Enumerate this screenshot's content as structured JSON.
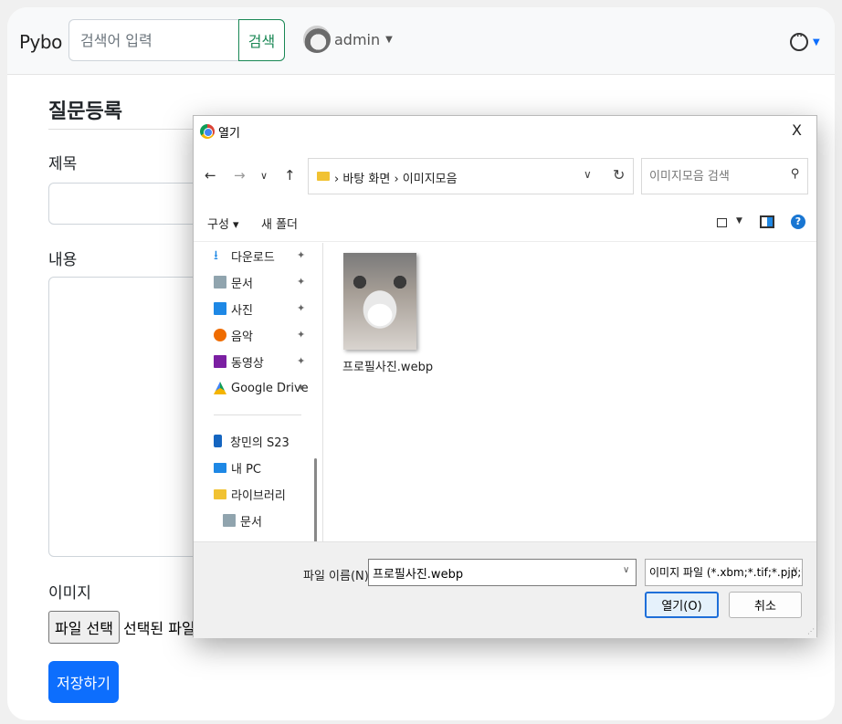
{
  "navbar": {
    "brand": "Pybo",
    "search_placeholder": "검색어 입력",
    "search_button": "검색",
    "username": "admin"
  },
  "form": {
    "title": "질문등록",
    "subject_label": "제목",
    "content_label": "내용",
    "image_label": "이미지",
    "file_button": "파일 선택",
    "file_status": "선택된 파일 없음",
    "save_button": "저장하기"
  },
  "dialog": {
    "title": "열기",
    "close": "X",
    "path": [
      "바탕 화면",
      "이미지모음"
    ],
    "search_placeholder": "이미지모음 검색",
    "toolbar": {
      "organize": "구성 ▾",
      "new_folder": "새 폴더"
    },
    "nav_items": [
      {
        "label": "다운로드",
        "icon": "download-icon",
        "pinned": true
      },
      {
        "label": "문서",
        "icon": "document-icon",
        "pinned": true
      },
      {
        "label": "사진",
        "icon": "pictures-icon",
        "pinned": true
      },
      {
        "label": "음악",
        "icon": "music-icon",
        "pinned": true
      },
      {
        "label": "동영상",
        "icon": "video-icon",
        "pinned": true
      },
      {
        "label": "Google Drive",
        "icon": "google-drive-icon",
        "pinned": true
      },
      {
        "label": "창민의 S23",
        "icon": "phone-icon",
        "pinned": false
      },
      {
        "label": "내 PC",
        "icon": "pc-icon",
        "pinned": false
      },
      {
        "label": "라이브러리",
        "icon": "folder-icon",
        "pinned": false
      },
      {
        "label": "문서",
        "icon": "document-icon",
        "pinned": false
      }
    ],
    "files": [
      {
        "name": "프로필사진.webp"
      }
    ],
    "filename_label": "파일 이름(N):",
    "filename_value": "프로필사진.webp",
    "filetype": "이미지 파일 (*.xbm;*.tif;*.pjp;*.a",
    "open_button": "열기(O)",
    "cancel_button": "취소"
  },
  "colors": {
    "primary": "#0d6efd",
    "success": "#198754"
  }
}
